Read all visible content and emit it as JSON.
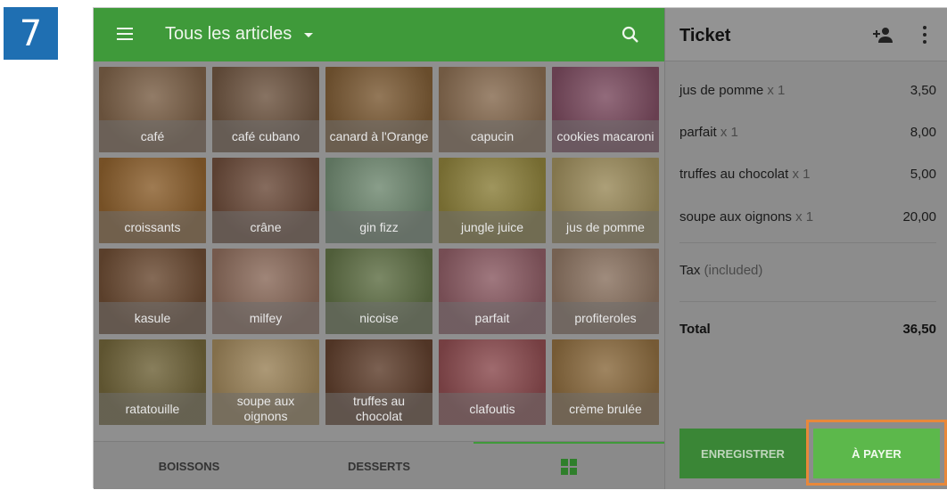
{
  "step_number": "7",
  "header": {
    "title": "Tous les articles"
  },
  "items": [
    {
      "label": "café",
      "color": "#7a5f46"
    },
    {
      "label": "café cubano",
      "color": "#6d5440"
    },
    {
      "label": "canard à l'Orange",
      "color": "#7b5a34"
    },
    {
      "label": "capucin",
      "color": "#866a4f"
    },
    {
      "label": "cookies macaroni",
      "color": "#7a4a5e"
    },
    {
      "label": "croissants",
      "color": "#8a5e2c"
    },
    {
      "label": "crâne",
      "color": "#6b4b3a"
    },
    {
      "label": "gin fizz",
      "color": "#6f8870"
    },
    {
      "label": "jungle juice",
      "color": "#8a7e3a"
    },
    {
      "label": "jus de pomme",
      "color": "#9a8a5a"
    },
    {
      "label": "kasule",
      "color": "#6a4a32"
    },
    {
      "label": "milfey",
      "color": "#8a6a5a"
    },
    {
      "label": "nicoise",
      "color": "#5e6e44"
    },
    {
      "label": "parfait",
      "color": "#8a5a62"
    },
    {
      "label": "profiteroles",
      "color": "#8a7260"
    },
    {
      "label": "ratatouille",
      "color": "#6e6238"
    },
    {
      "label": "soupe aux oignons",
      "color": "#9a8258"
    },
    {
      "label": "truffes au chocolat",
      "color": "#5e3e2c"
    },
    {
      "label": "clafoutis",
      "color": "#8a4a4e"
    },
    {
      "label": "crème brulée",
      "color": "#8a6a3e"
    }
  ],
  "tabs": {
    "drinks": "BOISSONS",
    "desserts": "DESSERTS"
  },
  "ticket": {
    "title": "Ticket",
    "lines": [
      {
        "name": "jus de pomme",
        "qty": "x 1",
        "price": "3,50"
      },
      {
        "name": "parfait",
        "qty": "x 1",
        "price": "8,00"
      },
      {
        "name": "truffes au chocolat",
        "qty": "x 1",
        "price": "5,00"
      },
      {
        "name": "soupe aux oignons",
        "qty": "x 1",
        "price": "20,00"
      }
    ],
    "tax_label": "Tax",
    "tax_note": "(included)",
    "total_label": "Total",
    "total_value": "36,50",
    "save_label": "ENREGISTRER",
    "pay_label": "À PAYER"
  }
}
